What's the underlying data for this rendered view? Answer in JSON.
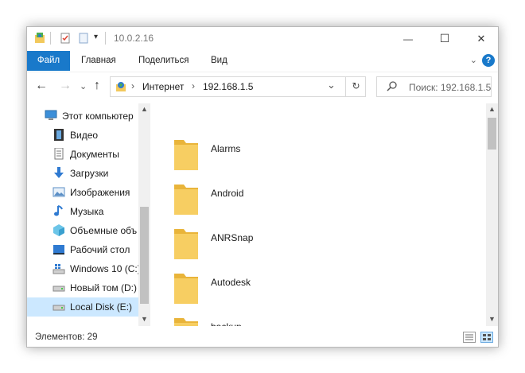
{
  "window": {
    "title": "10.0.2.16",
    "controls": {
      "minimize": "—",
      "maximize": "☐",
      "close": "✕"
    }
  },
  "ribbon": {
    "tabs": [
      "Файл",
      "Главная",
      "Поделиться",
      "Вид"
    ],
    "help": "?",
    "collapse": "⌄"
  },
  "address": {
    "segments": [
      "Интернет",
      "192.168.1.5"
    ],
    "separator": "›",
    "dropdown": "⌄",
    "refresh": "↻"
  },
  "search": {
    "placeholder": "Поиск: 192.168.1.5"
  },
  "navpane": {
    "items": [
      {
        "label": "Этот компьютер",
        "icon": "computer-icon"
      },
      {
        "label": "Видео",
        "icon": "video-icon"
      },
      {
        "label": "Документы",
        "icon": "documents-icon"
      },
      {
        "label": "Загрузки",
        "icon": "downloads-icon"
      },
      {
        "label": "Изображения",
        "icon": "pictures-icon"
      },
      {
        "label": "Музыка",
        "icon": "music-icon"
      },
      {
        "label": "Объемные объ",
        "icon": "3d-objects-icon"
      },
      {
        "label": "Рабочий стол",
        "icon": "desktop-icon"
      },
      {
        "label": "Windows 10 (C:)",
        "icon": "drive-windows-icon"
      },
      {
        "label": "Новый том (D:)",
        "icon": "drive-icon"
      },
      {
        "label": "Local Disk (E:)",
        "icon": "drive-icon",
        "selected": true
      }
    ]
  },
  "content": {
    "folders": [
      "Alarms",
      "Android",
      "ANRSnap",
      "Autodesk",
      "backup"
    ]
  },
  "status": {
    "items_count": "Элементов: 29"
  },
  "colors": {
    "accent": "#1979ca",
    "selection": "#cce8ff",
    "folder": "#f7ce62",
    "folder_dark": "#e9b43a"
  }
}
